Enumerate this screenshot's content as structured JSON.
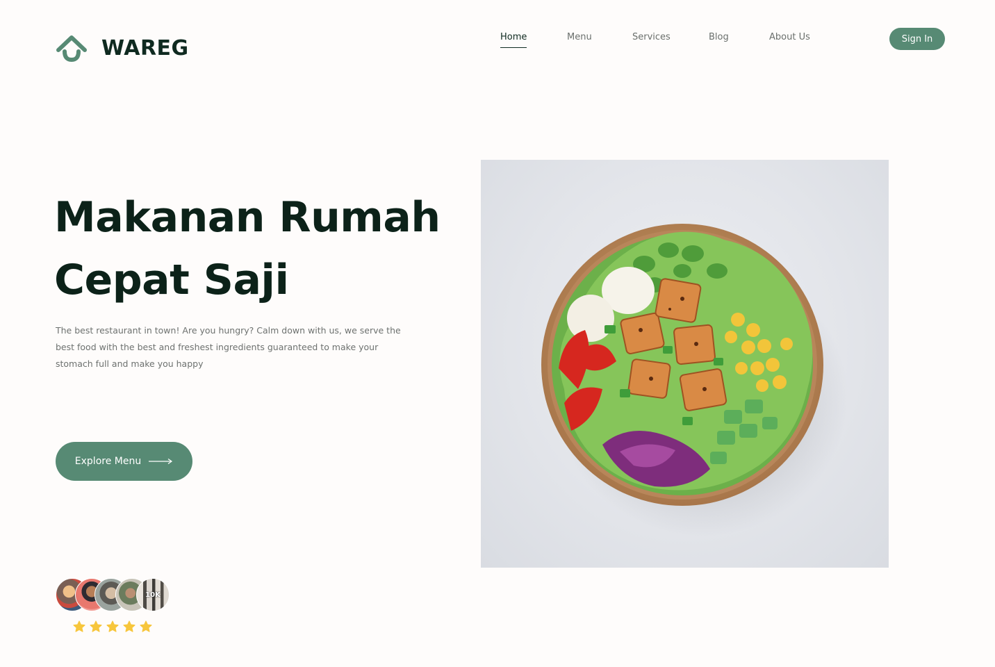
{
  "brand": {
    "name": "WAREG"
  },
  "nav": {
    "items": [
      {
        "label": "Home",
        "active": true
      },
      {
        "label": "Menu",
        "active": false
      },
      {
        "label": "Services",
        "active": false
      },
      {
        "label": "Blog",
        "active": false
      },
      {
        "label": "About Us",
        "active": false
      }
    ],
    "sign_in_label": "Sign In"
  },
  "hero": {
    "title_line1": "Makanan Rumah",
    "title_line2": "Cepat Saji",
    "description": "The best restaurant in town! Are you hungry? Calm down with us, we serve the best food with the best and freshest ingredients guaranteed to make your stomach full and make you happy",
    "cta_label": "Explore Menu"
  },
  "social_proof": {
    "customer_count": "10K",
    "rating": 5,
    "rating_max": 5
  },
  "colors": {
    "accent": "#578a74",
    "heading": "#0c2219",
    "star": "#f7c63c",
    "background": "#fefcfb"
  },
  "icons": {
    "logo": "house-smile-icon",
    "cta_arrow": "arrow-right-icon",
    "rating": "star-icon"
  }
}
